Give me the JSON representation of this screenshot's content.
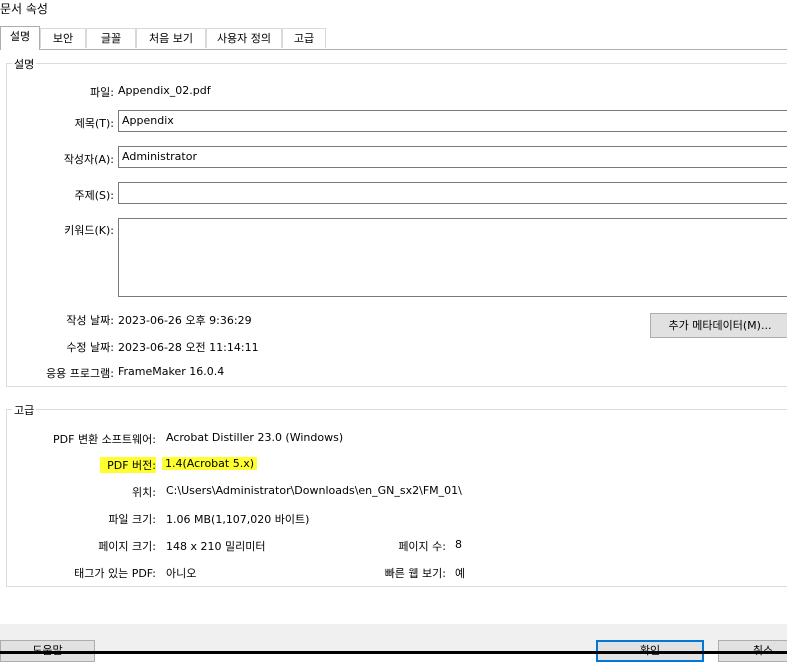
{
  "window": {
    "title": "문서 속성"
  },
  "tabs": [
    {
      "label": "설명"
    },
    {
      "label": "보안"
    },
    {
      "label": "글꼴"
    },
    {
      "label": "처음 보기"
    },
    {
      "label": "사용자 정의"
    },
    {
      "label": "고급"
    }
  ],
  "description": {
    "legend": "설명",
    "file_label": "파일:",
    "file_value": "Appendix_02.pdf",
    "title_label": "제목(T):",
    "title_value": "Appendix",
    "author_label": "작성자(A):",
    "author_value": "Administrator",
    "subject_label": "주제(S):",
    "subject_value": "",
    "keywords_label": "키워드(K):",
    "keywords_value": "",
    "created_label": "작성 날짜:",
    "created_value": "2023-06-26 오후 9:36:29",
    "modified_label": "수정 날짜:",
    "modified_value": "2023-06-28 오전 11:14:11",
    "app_label": "응용 프로그램:",
    "app_value": "FrameMaker 16.0.4",
    "metadata_button": "추가 메타데이터(M)..."
  },
  "advanced": {
    "legend": "고급",
    "producer_label": "PDF 변환 소프트웨어:",
    "producer_value": "Acrobat Distiller 23.0 (Windows)",
    "version_label": "PDF 버전:",
    "version_value": "1.4(Acrobat 5.x)",
    "location_label": "위치:",
    "location_value": "C:\\Users\\Administrator\\Downloads\\en_GN_sx2\\FM_01\\",
    "filesize_label": "파일 크기:",
    "filesize_value": "1.06 MB(1,107,020 바이트)",
    "pagesize_label": "페이지 크기:",
    "pagesize_value": "148 x 210 밀리미터",
    "pagecount_label": "페이지 수:",
    "pagecount_value": "8",
    "tagged_label": "태그가 있는 PDF:",
    "tagged_value": "아니오",
    "fastweb_label": "빠른 웹 보기:",
    "fastweb_value": "예"
  },
  "footer": {
    "help_button": "도움말",
    "ok_button": "확인",
    "cancel_button": "취소"
  },
  "colors": {
    "highlight": "#ffff30",
    "default_button_border": "#0078d7"
  }
}
